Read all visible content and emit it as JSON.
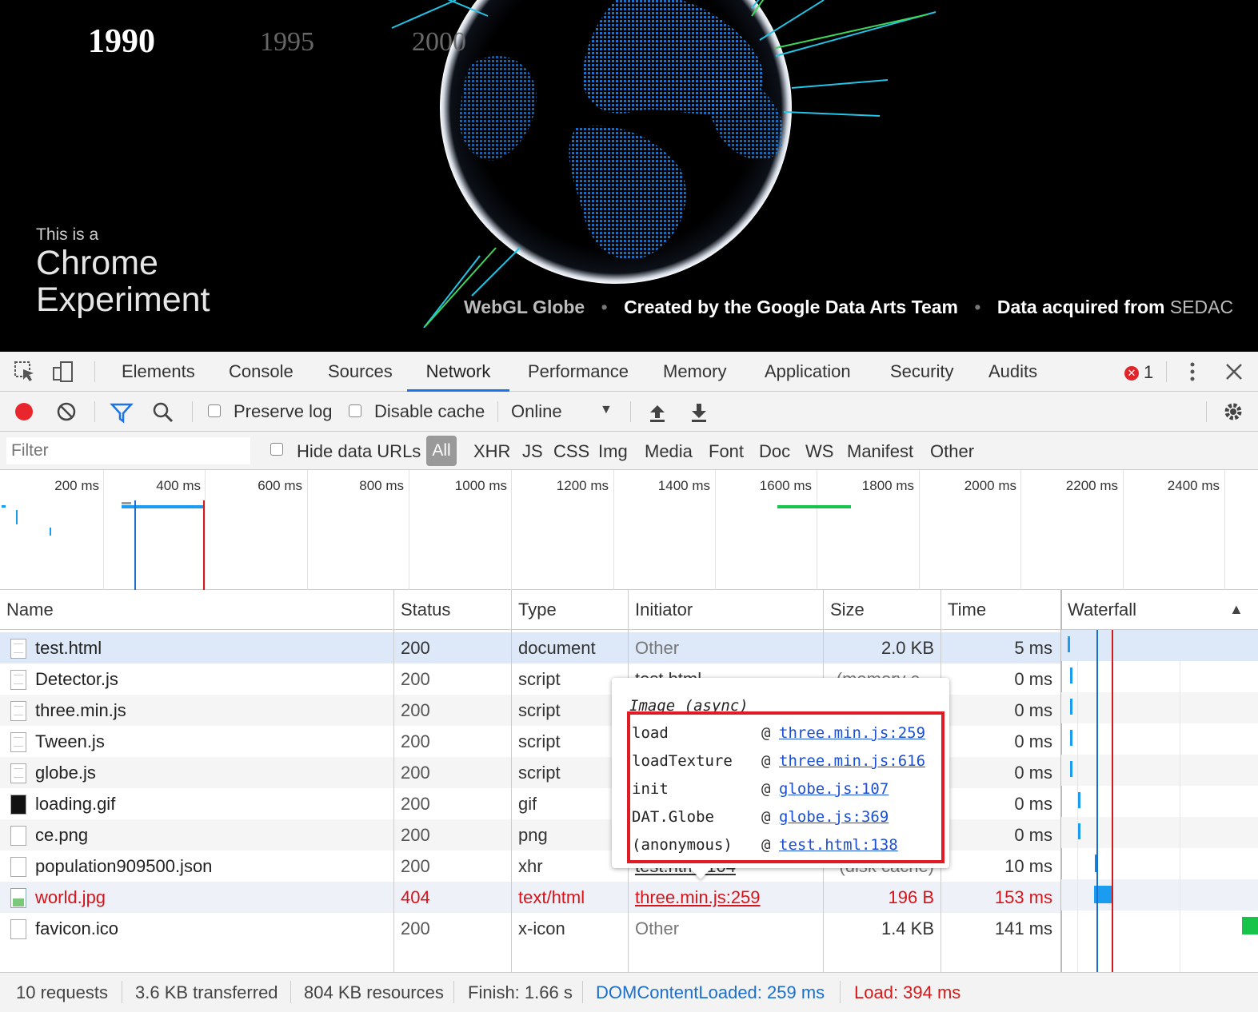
{
  "viewport": {
    "years": [
      "1990",
      "1995",
      "2000"
    ],
    "logo": {
      "line1": "This is a",
      "line2": "Chrome",
      "line3": "Experiment"
    },
    "credits": {
      "title": "WebGL Globe",
      "created": "Created by the Google Data Arts Team",
      "data_prefix": "Data acquired from",
      "data_source": "SEDAC"
    }
  },
  "devtools": {
    "tabs": [
      "Elements",
      "Console",
      "Sources",
      "Network",
      "Performance",
      "Memory",
      "Application",
      "Security",
      "Audits"
    ],
    "active_tab": "Network",
    "error_count": "1",
    "toolbar": {
      "preserve_log": "Preserve log",
      "disable_cache": "Disable cache",
      "throttle": "Online"
    },
    "filter": {
      "placeholder": "Filter",
      "hide_data_urls": "Hide data URLs",
      "types": [
        "All",
        "XHR",
        "JS",
        "CSS",
        "Img",
        "Media",
        "Font",
        "Doc",
        "WS",
        "Manifest",
        "Other"
      ]
    },
    "overview_ticks": [
      "200 ms",
      "400 ms",
      "600 ms",
      "800 ms",
      "1000 ms",
      "1200 ms",
      "1400 ms",
      "1600 ms",
      "1800 ms",
      "2000 ms",
      "2200 ms",
      "2400 ms"
    ],
    "columns": [
      "Name",
      "Status",
      "Type",
      "Initiator",
      "Size",
      "Time",
      "Waterfall"
    ],
    "rows": [
      {
        "name": "test.html",
        "status": "200",
        "type": "document",
        "initiator": "Other",
        "size": "2.0 KB",
        "time": "5 ms"
      },
      {
        "name": "Detector.js",
        "status": "200",
        "type": "script",
        "initiator": "test.html",
        "size": "(memory c...",
        "time": "0 ms"
      },
      {
        "name": "three.min.js",
        "status": "200",
        "type": "script",
        "initiator": "",
        "size": "",
        "time": "0 ms"
      },
      {
        "name": "Tween.js",
        "status": "200",
        "type": "script",
        "initiator": "",
        "size": "",
        "time": "0 ms"
      },
      {
        "name": "globe.js",
        "status": "200",
        "type": "script",
        "initiator": "",
        "size": "",
        "time": "0 ms"
      },
      {
        "name": "loading.gif",
        "status": "200",
        "type": "gif",
        "initiator": "",
        "size": "",
        "time": "0 ms"
      },
      {
        "name": "ce.png",
        "status": "200",
        "type": "png",
        "initiator": "",
        "size": "",
        "time": "0 ms"
      },
      {
        "name": "population909500.json",
        "status": "200",
        "type": "xhr",
        "initiator": "test.html:104",
        "size": "(disk cache)",
        "time": "10 ms"
      },
      {
        "name": "world.jpg",
        "status": "404",
        "type": "text/html",
        "initiator": "three.min.js:259",
        "size": "196 B",
        "time": "153 ms"
      },
      {
        "name": "favicon.ico",
        "status": "200",
        "type": "x-icon",
        "initiator": "Other",
        "size": "1.4 KB",
        "time": "141 ms"
      }
    ],
    "tooltip": {
      "title": "Image (async)",
      "frames": [
        {
          "fn": "load",
          "at": "@",
          "link": "three.min.js:259"
        },
        {
          "fn": "loadTexture",
          "at": "@",
          "link": "three.min.js:616"
        },
        {
          "fn": "init",
          "at": "@",
          "link": "globe.js:107"
        },
        {
          "fn": "DAT.Globe",
          "at": "@",
          "link": "globe.js:369"
        },
        {
          "fn": "(anonymous)",
          "at": "@",
          "link": "test.html:138"
        }
      ]
    },
    "summary": {
      "requests": "10 requests",
      "transferred": "3.6 KB transferred",
      "resources": "804 KB resources",
      "finish": "Finish: 1.66 s",
      "dcl": "DOMContentLoaded: 259 ms",
      "load": "Load: 394 ms"
    },
    "colors": {
      "accent": "#1a73e8",
      "error": "#d8141a",
      "dcl": "#1a6fcc",
      "load_line": "#d21a1a"
    }
  }
}
